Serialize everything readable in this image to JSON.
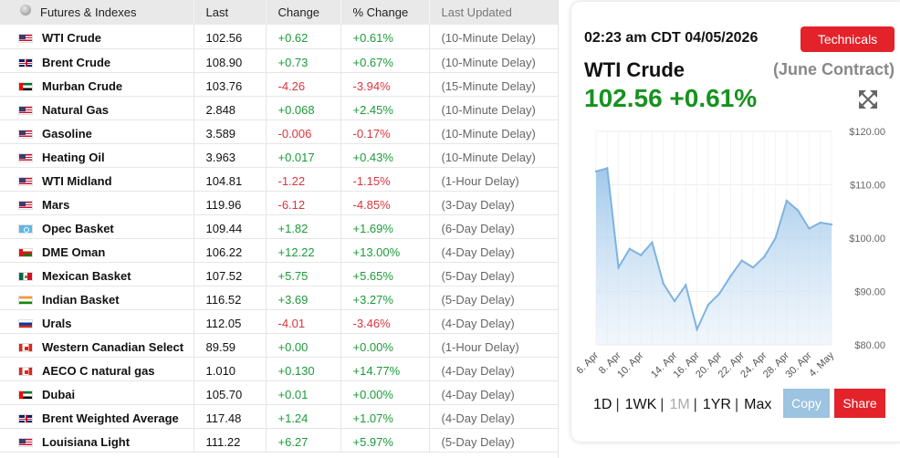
{
  "table": {
    "headers": {
      "name": "Futures & Indexes",
      "last": "Last",
      "change": "Change",
      "pct": "% Change",
      "updated": "Last Updated"
    },
    "rows": [
      {
        "flag": "us",
        "name": "WTI Crude",
        "last": "102.56",
        "change": "+0.62",
        "pct": "+0.61%",
        "updated": "(10-Minute Delay)",
        "dir": "pos"
      },
      {
        "flag": "uk",
        "name": "Brent Crude",
        "last": "108.90",
        "change": "+0.73",
        "pct": "+0.67%",
        "updated": "(10-Minute Delay)",
        "dir": "pos"
      },
      {
        "flag": "uae",
        "name": "Murban Crude",
        "last": "103.76",
        "change": "-4.26",
        "pct": "-3.94%",
        "updated": "(15-Minute Delay)",
        "dir": "neg"
      },
      {
        "flag": "us",
        "name": "Natural Gas",
        "last": "2.848",
        "change": "+0.068",
        "pct": "+2.45%",
        "updated": "(10-Minute Delay)",
        "dir": "pos"
      },
      {
        "flag": "us",
        "name": "Gasoline",
        "last": "3.589",
        "change": "-0.006",
        "pct": "-0.17%",
        "updated": "(10-Minute Delay)",
        "dir": "neg"
      },
      {
        "flag": "us",
        "name": "Heating Oil",
        "last": "3.963",
        "change": "+0.017",
        "pct": "+0.43%",
        "updated": "(10-Minute Delay)",
        "dir": "pos"
      },
      {
        "flag": "us",
        "name": "WTI Midland",
        "last": "104.81",
        "change": "-1.22",
        "pct": "-1.15%",
        "updated": "(1-Hour Delay)",
        "dir": "neg"
      },
      {
        "flag": "us",
        "name": "Mars",
        "last": "119.96",
        "change": "-6.12",
        "pct": "-4.85%",
        "updated": "(3-Day Delay)",
        "dir": "neg"
      },
      {
        "flag": "opec",
        "name": "Opec Basket",
        "last": "109.44",
        "change": "+1.82",
        "pct": "+1.69%",
        "updated": "(6-Day Delay)",
        "dir": "pos"
      },
      {
        "flag": "oman",
        "name": "DME Oman",
        "last": "106.22",
        "change": "+12.22",
        "pct": "+13.00%",
        "updated": "(4-Day Delay)",
        "dir": "pos"
      },
      {
        "flag": "mx",
        "name": "Mexican Basket",
        "last": "107.52",
        "change": "+5.75",
        "pct": "+5.65%",
        "updated": "(5-Day Delay)",
        "dir": "pos"
      },
      {
        "flag": "in",
        "name": "Indian Basket",
        "last": "116.52",
        "change": "+3.69",
        "pct": "+3.27%",
        "updated": "(5-Day Delay)",
        "dir": "pos"
      },
      {
        "flag": "ru",
        "name": "Urals",
        "last": "112.05",
        "change": "-4.01",
        "pct": "-3.46%",
        "updated": "(4-Day Delay)",
        "dir": "neg"
      },
      {
        "flag": "ca",
        "name": "Western Canadian Select",
        "last": "89.59",
        "change": "+0.00",
        "pct": "+0.00%",
        "updated": "(1-Hour Delay)",
        "dir": "pos"
      },
      {
        "flag": "ca",
        "name": "AECO C natural gas",
        "last": "1.010",
        "change": "+0.130",
        "pct": "+14.77%",
        "updated": "(4-Day Delay)",
        "dir": "pos"
      },
      {
        "flag": "uae",
        "name": "Dubai",
        "last": "105.70",
        "change": "+0.01",
        "pct": "+0.00%",
        "updated": "(4-Day Delay)",
        "dir": "pos"
      },
      {
        "flag": "uk",
        "name": "Brent Weighted Average",
        "last": "117.48",
        "change": "+1.24",
        "pct": "+1.07%",
        "updated": "(4-Day Delay)",
        "dir": "pos"
      },
      {
        "flag": "us",
        "name": "Louisiana Light",
        "last": "111.22",
        "change": "+6.27",
        "pct": "+5.97%",
        "updated": "(5-Day Delay)",
        "dir": "pos"
      }
    ]
  },
  "card": {
    "timestamp": "02:23 am CDT 04/05/2026",
    "technicals_label": "Technicals",
    "title": "WTI Crude",
    "contract": "(June Contract)",
    "price": "102.56 +0.61%",
    "expand_icon": "expand-arrows-icon",
    "ranges": [
      "1D",
      "1WK",
      "1M",
      "1YR",
      "Max"
    ],
    "active_range": "1M",
    "copy_label": "Copy",
    "share_label": "Share"
  },
  "chart_data": {
    "type": "area",
    "x": [
      "6. Apr",
      "7. Apr",
      "8. Apr",
      "9. Apr",
      "10. Apr",
      "11. Apr",
      "13. Apr",
      "14. Apr",
      "15. Apr",
      "16. Apr",
      "17. Apr",
      "20. Apr",
      "21. Apr",
      "22. Apr",
      "23. Apr",
      "24. Apr",
      "27. Apr",
      "28. Apr",
      "29. Apr",
      "30. Apr",
      "1. May",
      "4. May"
    ],
    "values": [
      112.5,
      113.1,
      94.5,
      98.0,
      96.8,
      99.2,
      91.5,
      88.2,
      91.2,
      82.9,
      87.5,
      89.6,
      92.9,
      95.8,
      94.5,
      96.5,
      100.0,
      107.0,
      105.2,
      101.8,
      102.9,
      102.56
    ],
    "tick_labels": [
      "6. Apr",
      "8. Apr",
      "10. Apr",
      "14. Apr",
      "16. Apr",
      "20. Apr",
      "22. Apr",
      "24. Apr",
      "28. Apr",
      "30. Apr",
      "4. May"
    ],
    "y_ticks": [
      "$80.00",
      "$90.00",
      "$100.00",
      "$110.00",
      "$120.00"
    ],
    "ylim": [
      80,
      120
    ],
    "color": "#7fb3e0",
    "grid": true
  }
}
